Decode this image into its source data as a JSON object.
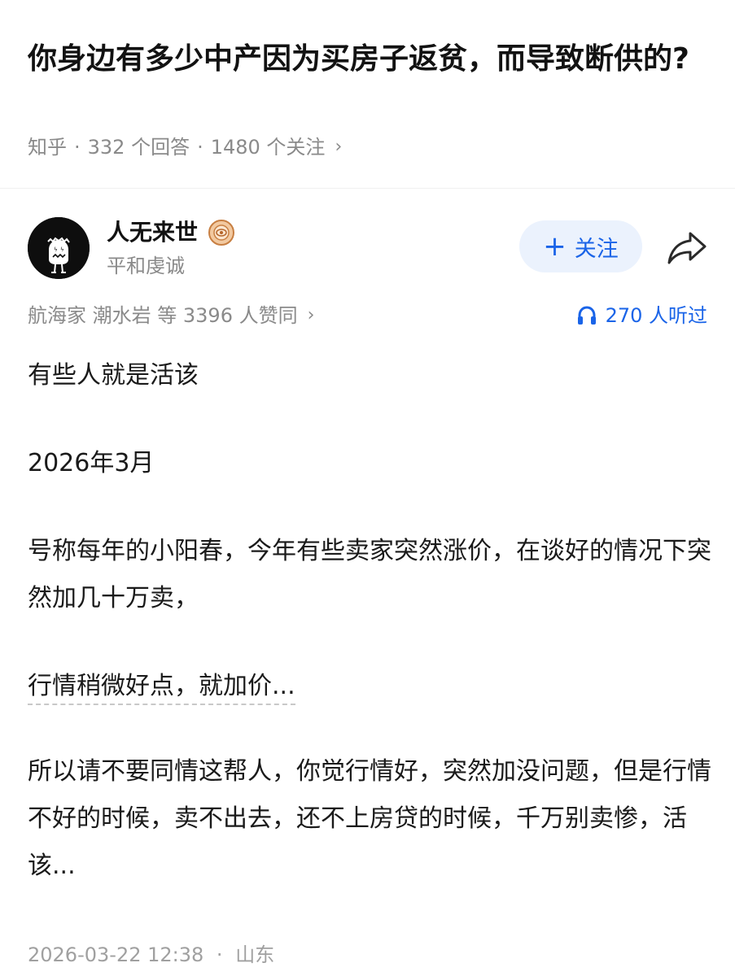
{
  "question": {
    "title": "你身边有多少中产因为买房子返贫，而导致断供的?",
    "source": "知乎",
    "answers": "332 个回答",
    "followers": "1480 个关注",
    "sep": "·"
  },
  "author": {
    "name": "人无来世",
    "bio": "平和虔诚",
    "follow_label": "关注"
  },
  "stats": {
    "endorsements": "航海家 潮水岩 等 3396 人赞同",
    "listens": "270 人听过"
  },
  "answer": {
    "p1": "有些人就是活该",
    "p2": "2026年3月",
    "p3": "号称每年的小阳春，今年有些卖家突然涨价，在谈好的情况下突然加几十万卖，",
    "p4": "行情稍微好点，就加价...",
    "p5": "所以请不要同情这帮人，你觉行情好，突然加没问题，但是行情不好的时候，卖不出去，还不上房贷的时候，千万别卖惨，活该..."
  },
  "footer": {
    "date": "2026-03-22 12:38",
    "location": "山东",
    "sep": "·"
  },
  "colors": {
    "accent": "#1a64e8",
    "follow_bg": "#ebf2fd",
    "meta_gray": "#8a8a8a"
  }
}
